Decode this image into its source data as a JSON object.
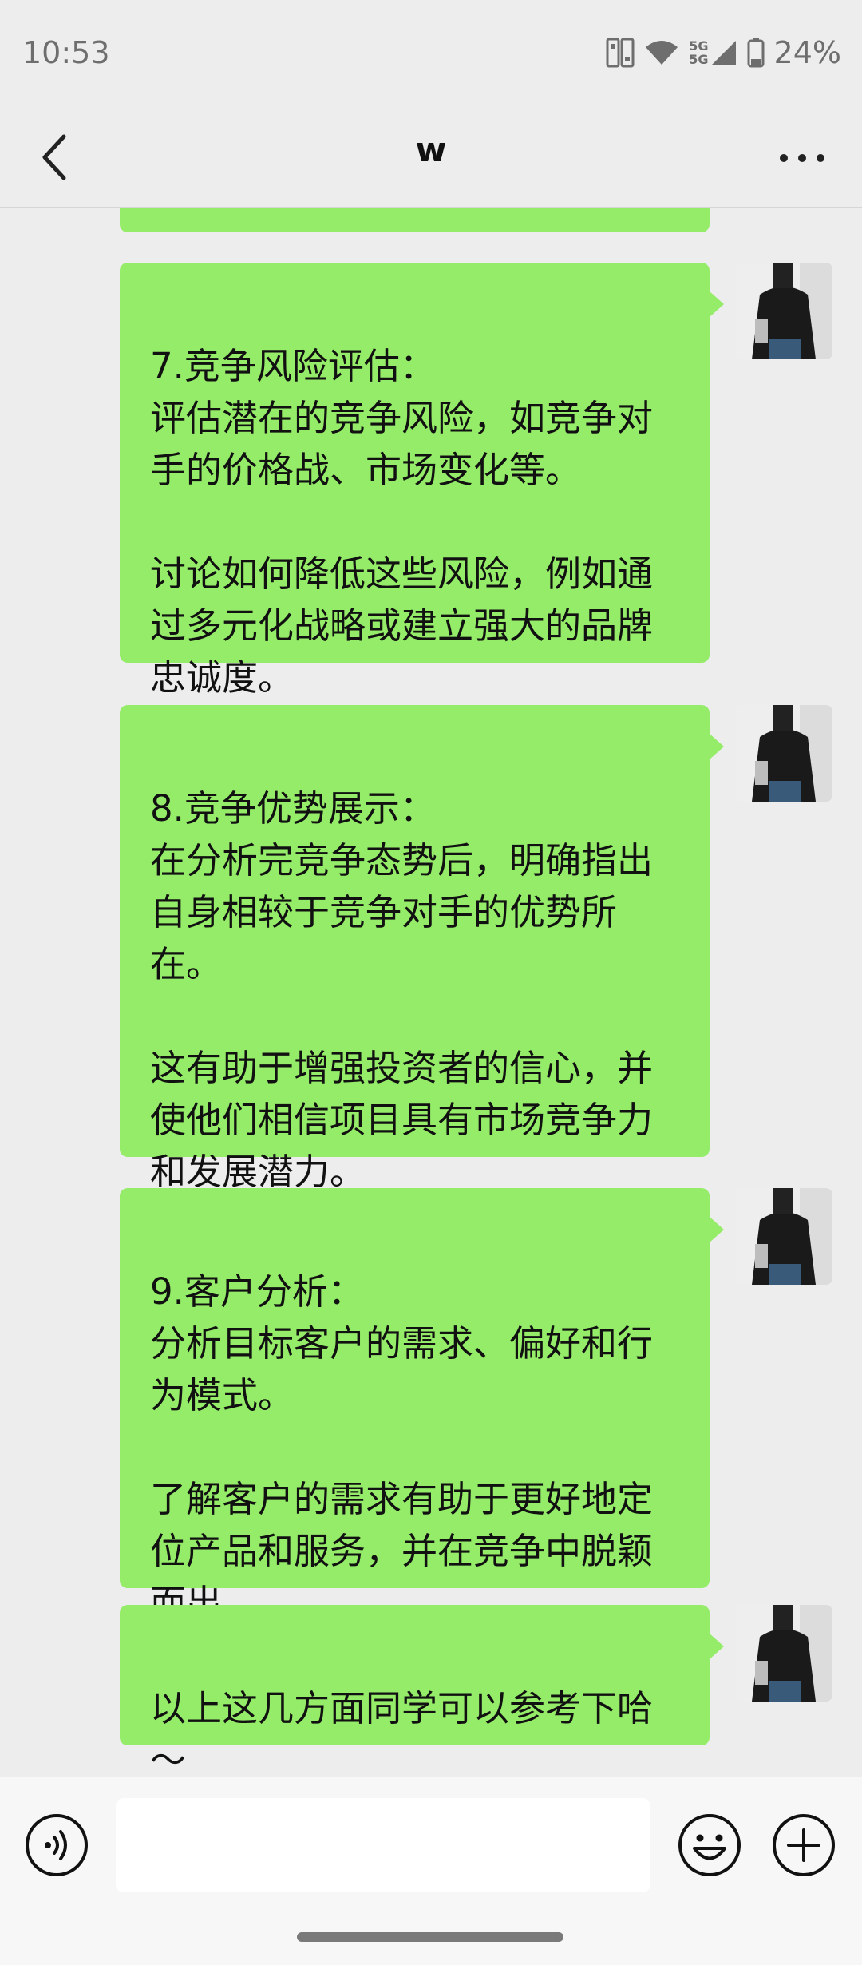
{
  "status_bar": {
    "time": "10:53",
    "network_label": "5G",
    "battery": "24%"
  },
  "nav": {
    "title": "w",
    "back_icon": "chevron-left-icon",
    "more_icon": "more-dots-icon"
  },
  "messages": [
    {
      "sender": "self",
      "text": ""
    },
    {
      "sender": "self",
      "text": "7.竞争风险评估：\n评估潜在的竞争风险，如竞争对手的价格战、市场变化等。\n\n讨论如何降低这些风险，例如通过多元化战略或建立强大的品牌忠诚度。"
    },
    {
      "sender": "self",
      "text": "8.竞争优势展示：\n在分析完竞争态势后，明确指出自身相较于竞争对手的优势所在。\n\n这有助于增强投资者的信心，并使他们相信项目具有市场竞争力和发展潜力。"
    },
    {
      "sender": "self",
      "text": "9.客户分析：\n分析目标客户的需求、偏好和行为模式。\n\n了解客户的需求有助于更好地定位产品和服务，并在竞争中脱颖而出。"
    },
    {
      "sender": "self",
      "text": "以上这几方面同学可以参考下哈～"
    }
  ],
  "input_bar": {
    "message_value": "",
    "icons": [
      "voice-icon",
      "emoji-icon",
      "plus-icon"
    ]
  },
  "colors": {
    "background": "#ededed",
    "bubble": "#95ec69",
    "input_bar": "#f7f7f7"
  }
}
